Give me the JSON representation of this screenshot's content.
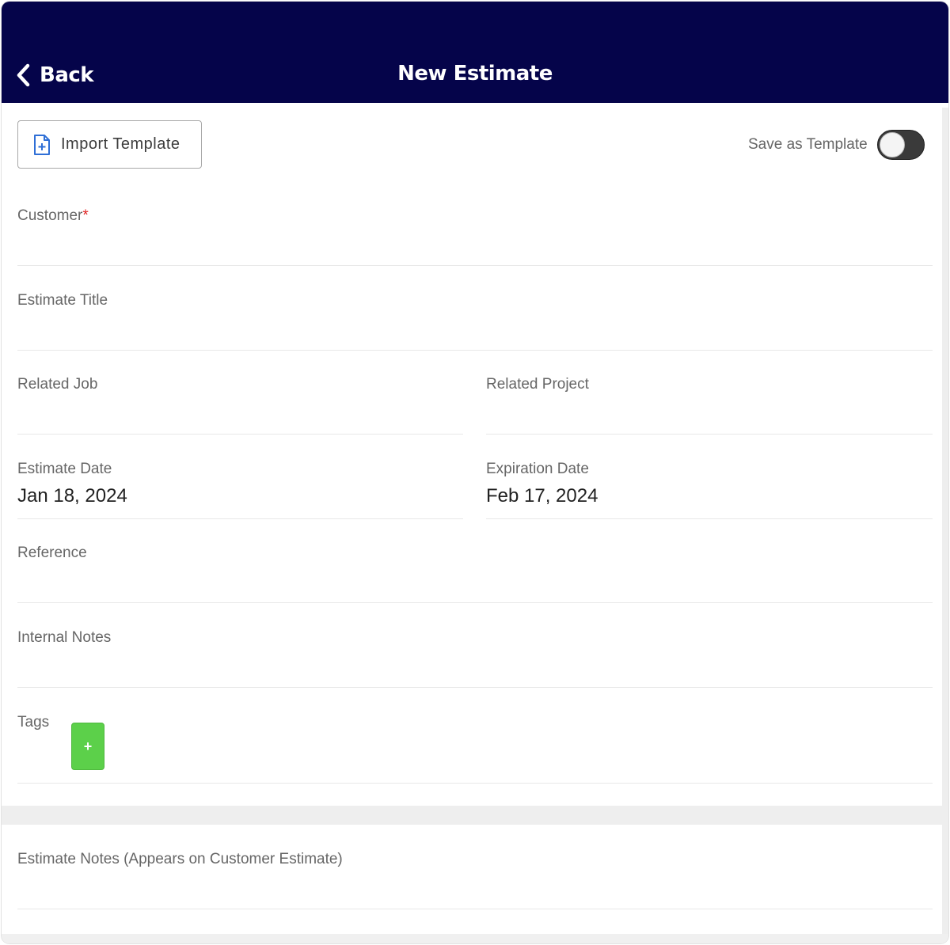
{
  "nav": {
    "back_label": "Back",
    "title": "New Estimate"
  },
  "toolbar": {
    "import_label": "Import Template",
    "save_template_label": "Save as Template",
    "save_template_on": false
  },
  "form": {
    "customer_label": "Customer",
    "customer_required_mark": "*",
    "customer_value": "",
    "estimate_title_label": "Estimate Title",
    "estimate_title_value": "",
    "related_job_label": "Related Job",
    "related_job_value": "",
    "related_project_label": "Related Project",
    "related_project_value": "",
    "estimate_date_label": "Estimate Date",
    "estimate_date_value": "Jan 18, 2024",
    "expiration_date_label": "Expiration Date",
    "expiration_date_value": "Feb 17, 2024",
    "reference_label": "Reference",
    "reference_value": "",
    "internal_notes_label": "Internal Notes",
    "internal_notes_value": "",
    "tags_label": "Tags",
    "add_tag_label": "+",
    "estimate_notes_label": "Estimate Notes (Appears on Customer Estimate)",
    "estimate_notes_value": ""
  },
  "colors": {
    "nav_bg": "#05044a",
    "accent_green": "#5cd04a",
    "required": "#e02424",
    "import_icon": "#2f6fd6"
  },
  "icons": {
    "back": "chevron-left-icon",
    "import": "document-plus-icon"
  }
}
